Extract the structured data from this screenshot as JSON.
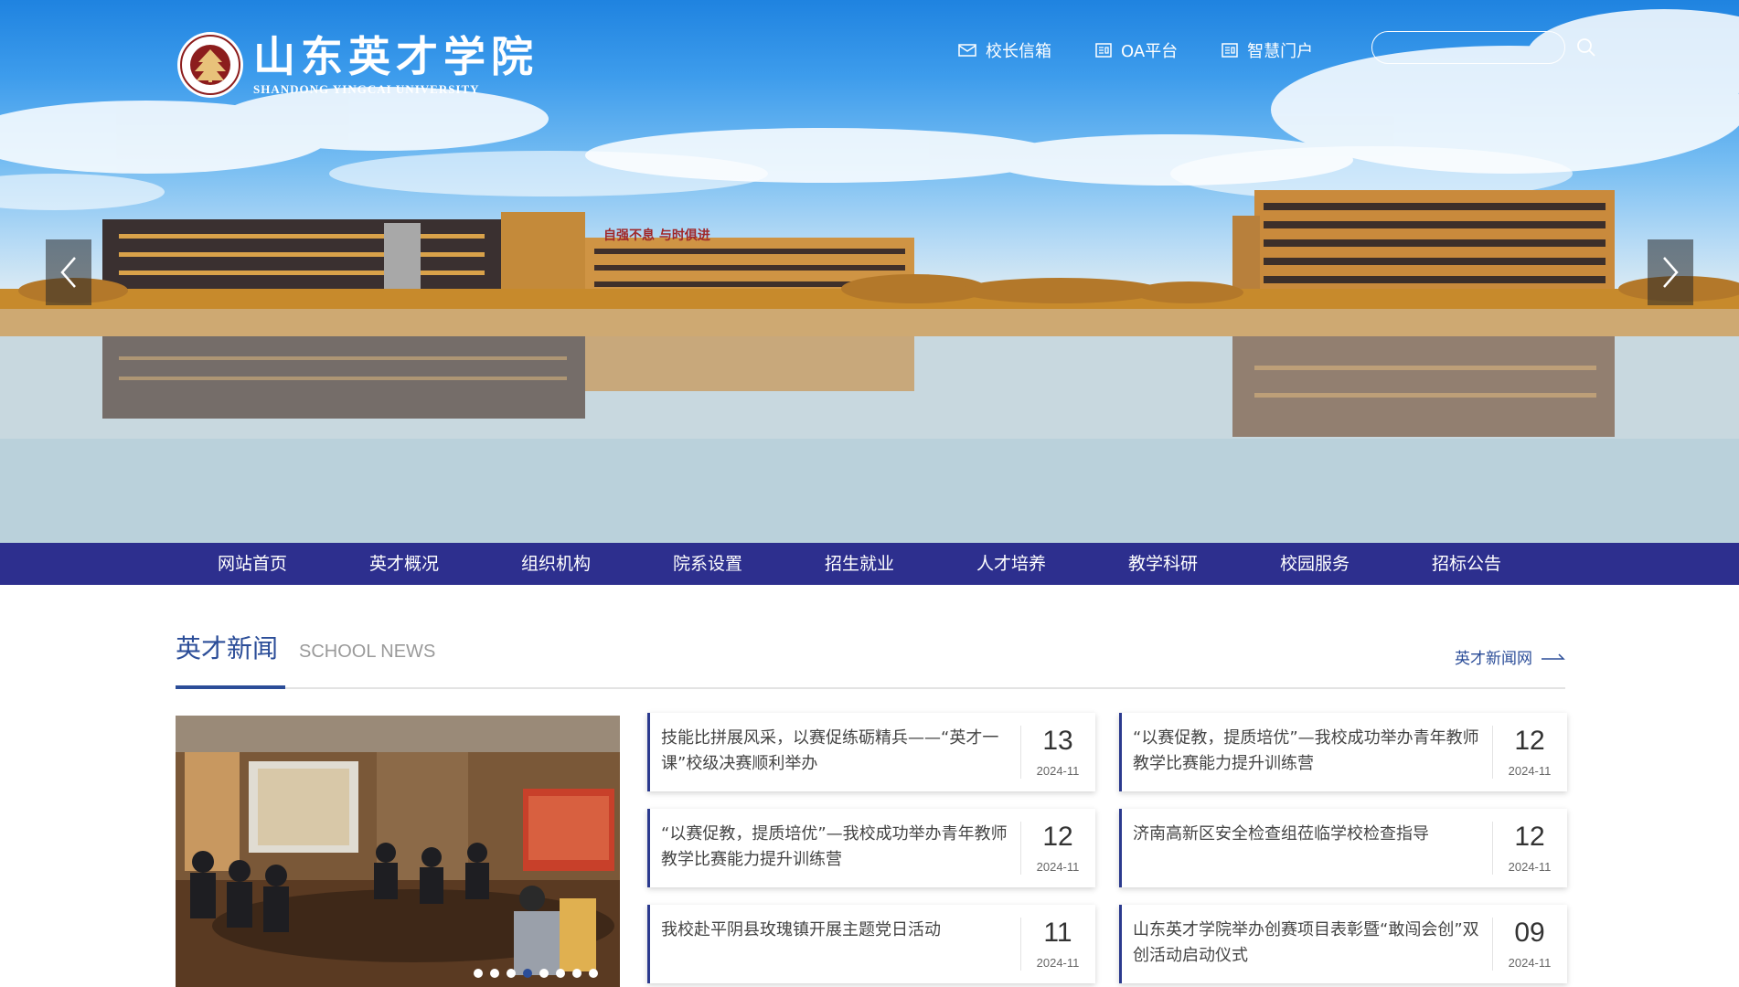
{
  "header": {
    "logo_cn": "山东英才学院",
    "logo_en": "SHANDONG YINGCAI UNIVERSITY",
    "links": [
      {
        "label": "校长信箱",
        "icon": "mail-icon"
      },
      {
        "label": "OA平台",
        "icon": "oa-icon"
      },
      {
        "label": "智慧门户",
        "icon": "portal-icon"
      }
    ],
    "search": {
      "value": "",
      "placeholder": ""
    }
  },
  "banner": {
    "building_sign": "自强不息 与时俱进"
  },
  "nav": {
    "items": [
      "网站首页",
      "英才概况",
      "组织机构",
      "院系设置",
      "招生就业",
      "人才培养",
      "教学科研",
      "校园服务",
      "招标公告"
    ]
  },
  "news": {
    "title": "英才新闻",
    "subtitle": "SCHOOL NEWS",
    "more_label": "英才新闻网",
    "carousel": {
      "slides": 8,
      "active_index": 3
    },
    "items": [
      {
        "title": "技能比拼展风采，以赛促练砺精兵——“英才一课”校级决赛顺利举办",
        "day": "13",
        "ym": "2024-11"
      },
      {
        "title": "“以赛促教，提质培优”—我校成功举办青年教师教学比赛能力提升训练营",
        "day": "12",
        "ym": "2024-11"
      },
      {
        "title": "“以赛促教，提质培优”—我校成功举办青年教师教学比赛能力提升训练营",
        "day": "12",
        "ym": "2024-11"
      },
      {
        "title": "济南高新区安全检查组莅临学校检查指导",
        "day": "12",
        "ym": "2024-11"
      },
      {
        "title": "我校赴平阴县玫瑰镇开展主题党日活动",
        "day": "11",
        "ym": "2024-11"
      },
      {
        "title": "山东英才学院举办创赛项目表彰暨“敢闯会创”双创活动启动仪式",
        "day": "09",
        "ym": "2024-11"
      }
    ]
  },
  "colors": {
    "nav_bg": "#2d2f8e",
    "accent": "#2b4d98",
    "sky": "#1f83e0"
  }
}
